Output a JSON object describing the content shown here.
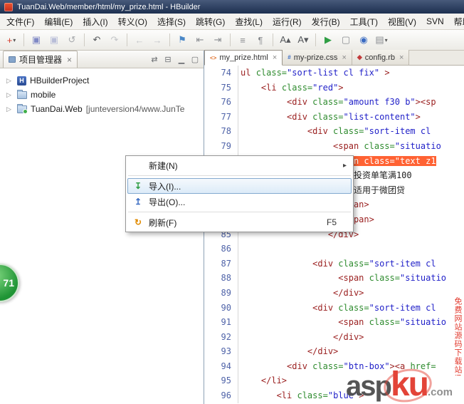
{
  "titlebar": {
    "title": "TuanDai.Web/member/html/my_prize.html - HBuilder",
    "app_icon": "hbuilder-logo"
  },
  "menubar": {
    "items": [
      "文件(F)",
      "编辑(E)",
      "插入(I)",
      "转义(O)",
      "选择(S)",
      "跳转(G)",
      "查找(L)",
      "运行(R)",
      "发行(B)",
      "工具(T)",
      "视图(V)",
      "SVN",
      "帮助"
    ]
  },
  "toolbar": {
    "caret": "▾",
    "groups": [
      {
        "icons": [
          {
            "name": "new-file",
            "glyph": "+",
            "color": "#d43b2a",
            "caret": true
          }
        ]
      },
      {
        "icons": [
          {
            "name": "save",
            "glyph": "▣",
            "color": "#8089c5"
          },
          {
            "name": "save-all",
            "glyph": "▣",
            "color": "#b8bdd8"
          },
          {
            "name": "refresh-file",
            "glyph": "↺",
            "color": "#a8aaad"
          }
        ]
      },
      {
        "icons": [
          {
            "name": "undo",
            "glyph": "↶",
            "color": "#55585c"
          },
          {
            "name": "redo",
            "glyph": "↷",
            "color": "#c3c5c8"
          }
        ]
      },
      {
        "icons": [
          {
            "name": "nav-back",
            "glyph": "←",
            "color": "#c3c5c8"
          },
          {
            "name": "nav-forward",
            "glyph": "→",
            "color": "#c3c5c8"
          }
        ]
      },
      {
        "icons": [
          {
            "name": "bookmark",
            "glyph": "⚑",
            "color": "#4a87c7"
          },
          {
            "name": "previous-mark",
            "glyph": "⇤",
            "color": "#8b8e92"
          },
          {
            "name": "next-mark",
            "glyph": "⇥",
            "color": "#8b8e92"
          }
        ]
      },
      {
        "icons": [
          {
            "name": "reformat",
            "glyph": "≡",
            "color": "#8b8e92"
          },
          {
            "name": "comment",
            "glyph": "¶",
            "color": "#8b8e92"
          }
        ]
      },
      {
        "icons": [
          {
            "name": "font-increase",
            "glyph": "A▴",
            "color": "#55585c"
          },
          {
            "name": "font-decrease",
            "glyph": "A▾",
            "color": "#55585c"
          }
        ]
      },
      {
        "icons": [
          {
            "name": "run",
            "glyph": "▶",
            "color": "#2f9e44"
          },
          {
            "name": "terminal",
            "glyph": "▢",
            "color": "#8b8e92"
          },
          {
            "name": "browser",
            "glyph": "◉",
            "color": "#3a6bc2"
          },
          {
            "name": "more-tools",
            "glyph": "▤",
            "color": "#8b8e92",
            "caret": true
          }
        ]
      }
    ]
  },
  "project_panel": {
    "title": "项目管理器",
    "close_glyph": "×",
    "twisty_glyph": "▷",
    "header_icons": [
      {
        "name": "link-with-editor",
        "glyph": "⇄"
      },
      {
        "name": "collapse-all",
        "glyph": "⊟"
      },
      {
        "name": "minimize-view",
        "glyph": "▁"
      },
      {
        "name": "maximize-view",
        "glyph": "▢"
      }
    ],
    "tree": [
      {
        "label": "HBuilderProject",
        "icon": "hbuilder-project",
        "badge": "H"
      },
      {
        "label": "mobile",
        "icon": "folder"
      },
      {
        "label": "TuanDai.Web",
        "suffix": " [junteversion4/www.JunTe",
        "icon": "folder-svn"
      }
    ]
  },
  "editor": {
    "tab_close_glyph": "×",
    "tabs": [
      {
        "label": "my_prize.html",
        "icon": "html",
        "glyph": "<>",
        "active": true
      },
      {
        "label": "my-prize.css",
        "icon": "css",
        "glyph": "#",
        "active": false
      },
      {
        "label": "config.rb",
        "icon": "rb",
        "glyph": "◆",
        "active": false
      }
    ],
    "code_lines": [
      {
        "num": 74,
        "indent": 0,
        "tokens": [
          [
            "tag",
            "ul "
          ],
          [
            "attr",
            "class="
          ],
          [
            "str",
            "\"sort-list cl fix\""
          ],
          [
            "plain",
            " "
          ],
          [
            "tag",
            ">"
          ]
        ]
      },
      {
        "num": 75,
        "indent": 4,
        "tokens": [
          [
            "tag",
            "<li "
          ],
          [
            "attr",
            "class="
          ],
          [
            "str",
            "\"red\""
          ],
          [
            "tag",
            ">"
          ]
        ]
      },
      {
        "num": 76,
        "indent": 9,
        "tokens": [
          [
            "tag",
            "<div "
          ],
          [
            "attr",
            "class="
          ],
          [
            "str",
            "\"amount f30 b\""
          ],
          [
            "tag",
            "><sp"
          ]
        ]
      },
      {
        "num": 77,
        "indent": 9,
        "tokens": [
          [
            "tag",
            "<div "
          ],
          [
            "attr",
            "class="
          ],
          [
            "str",
            "\"list-content\""
          ],
          [
            "tag",
            ">"
          ]
        ]
      },
      {
        "num": 78,
        "indent": 13,
        "tokens": [
          [
            "tag",
            "<div "
          ],
          [
            "attr",
            "class="
          ],
          [
            "str",
            "\"sort-item cl"
          ]
        ]
      },
      {
        "num": 79,
        "indent": 18,
        "tokens": [
          [
            "tag",
            "<span "
          ],
          [
            "attr",
            "class="
          ],
          [
            "str",
            "\"situatio"
          ]
        ]
      },
      {
        "num": 80,
        "indent": 18,
        "tokens": [
          [
            "tag",
            "<spa"
          ],
          [
            "hl",
            "n class=\"text z1"
          ]
        ]
      },
      {
        "num": 81,
        "indent": 22,
        "tokens": [
          [
            "cjk",
            "投资单笔满100"
          ]
        ]
      },
      {
        "num": 82,
        "indent": 22,
        "tokens": [
          [
            "cjk",
            "适用于微团贷"
          ]
        ]
      },
      {
        "num": 83,
        "indent": 18,
        "tokens": [
          [
            "tag",
            "</span>"
          ]
        ]
      },
      {
        "num": 84,
        "indent": 19,
        "tokens": [
          [
            "tag",
            "</span>"
          ]
        ]
      },
      {
        "num": 85,
        "indent": 17,
        "tokens": [
          [
            "tag",
            "</div>"
          ]
        ]
      },
      {
        "num": 86,
        "indent": 0,
        "tokens": []
      },
      {
        "num": 87,
        "indent": 14,
        "tokens": [
          [
            "tag",
            "<div "
          ],
          [
            "attr",
            "class="
          ],
          [
            "str",
            "\"sort-item cl"
          ]
        ]
      },
      {
        "num": 88,
        "indent": 19,
        "tokens": [
          [
            "tag",
            "<span "
          ],
          [
            "attr",
            "class="
          ],
          [
            "str",
            "\"situatio"
          ]
        ]
      },
      {
        "num": 89,
        "indent": 18,
        "tokens": [
          [
            "tag",
            "</div>"
          ]
        ]
      },
      {
        "num": 90,
        "indent": 14,
        "tokens": [
          [
            "tag",
            "<div "
          ],
          [
            "attr",
            "class="
          ],
          [
            "str",
            "\"sort-item cl"
          ]
        ]
      },
      {
        "num": 91,
        "indent": 19,
        "tokens": [
          [
            "tag",
            "<span "
          ],
          [
            "attr",
            "class="
          ],
          [
            "str",
            "\"situatio"
          ]
        ]
      },
      {
        "num": 92,
        "indent": 18,
        "tokens": [
          [
            "tag",
            "</div>"
          ]
        ]
      },
      {
        "num": 93,
        "indent": 13,
        "tokens": [
          [
            "tag",
            "</div>"
          ]
        ]
      },
      {
        "num": 94,
        "indent": 9,
        "tokens": [
          [
            "tag",
            "<div "
          ],
          [
            "attr",
            "class="
          ],
          [
            "str",
            "\"btn-box\""
          ],
          [
            "tag",
            "><a "
          ],
          [
            "attr",
            "href="
          ]
        ]
      },
      {
        "num": 95,
        "indent": 4,
        "tokens": [
          [
            "tag",
            "</li>"
          ]
        ]
      },
      {
        "num": 96,
        "indent": 7,
        "tokens": [
          [
            "tag",
            "<li "
          ],
          [
            "attr",
            "class="
          ],
          [
            "str",
            "\"blue\""
          ],
          [
            "tag",
            ">"
          ]
        ]
      }
    ]
  },
  "context_menu": {
    "submenu_arrow": "▸",
    "items": [
      {
        "type": "item",
        "label": "新建(N)",
        "submenu": true
      },
      {
        "type": "sep"
      },
      {
        "type": "item",
        "label": "导入(I)...",
        "icon": "import",
        "glyph": "↧",
        "glyph_color": "#2f9e44",
        "selected": true
      },
      {
        "type": "item",
        "label": "导出(O)...",
        "icon": "export",
        "glyph": "↥",
        "glyph_color": "#3a6bc2"
      },
      {
        "type": "sep"
      },
      {
        "type": "item",
        "label": "刷新(F)",
        "icon": "refresh",
        "glyph": "↻",
        "glyph_color": "#e08a00",
        "shortcut": "F5"
      }
    ]
  },
  "overlay_badge": {
    "text": "71"
  },
  "watermark": {
    "part1": "asp",
    "part2": "ku",
    "part3": ".com",
    "tagline": "免费网站源码下载站!"
  }
}
